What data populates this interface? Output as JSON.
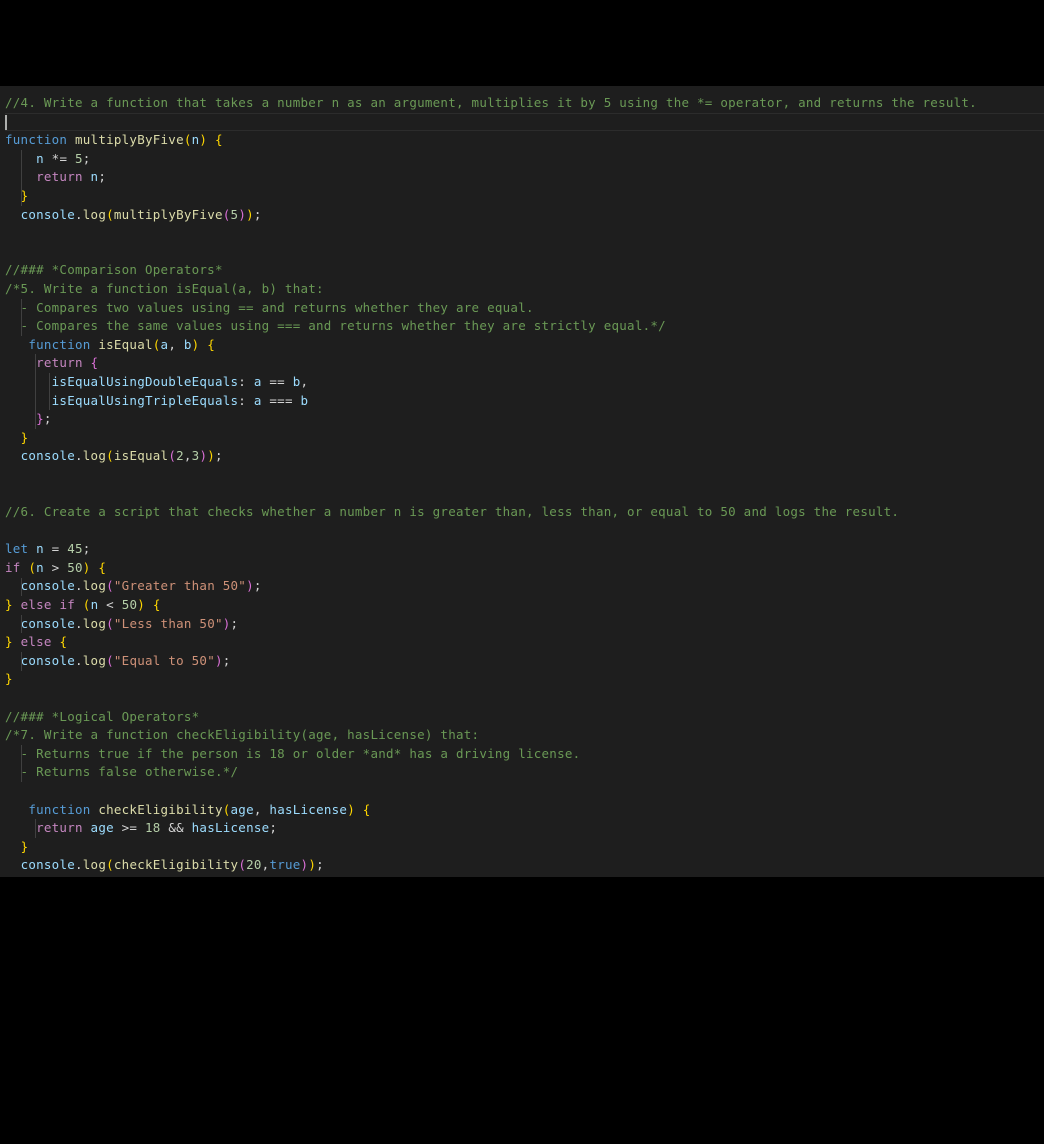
{
  "editor": {
    "lines": [
      [
        {
          "t": "//4. Write a function that takes a number n as an argument, multiplies it by 5 using the *= operator, and returns the result.",
          "c": "comment"
        }
      ],
      [],
      [
        {
          "t": "function",
          "c": "keyword"
        },
        {
          "t": " ",
          "c": "plain"
        },
        {
          "t": "multiplyByFive",
          "c": "func"
        },
        {
          "t": "(",
          "c": "brace1"
        },
        {
          "t": "n",
          "c": "var"
        },
        {
          "t": ")",
          "c": "brace1"
        },
        {
          "t": " ",
          "c": "plain"
        },
        {
          "t": "{",
          "c": "brace1"
        }
      ],
      [
        {
          "t": "    ",
          "c": "plain"
        },
        {
          "t": "n",
          "c": "var"
        },
        {
          "t": " *= ",
          "c": "plain"
        },
        {
          "t": "5",
          "c": "num"
        },
        {
          "t": ";",
          "c": "plain"
        }
      ],
      [
        {
          "t": "    ",
          "c": "plain"
        },
        {
          "t": "return",
          "c": "control"
        },
        {
          "t": " ",
          "c": "plain"
        },
        {
          "t": "n",
          "c": "var"
        },
        {
          "t": ";",
          "c": "plain"
        }
      ],
      [
        {
          "t": "  ",
          "c": "plain"
        },
        {
          "t": "}",
          "c": "brace1"
        }
      ],
      [
        {
          "t": "  ",
          "c": "plain"
        },
        {
          "t": "console",
          "c": "var"
        },
        {
          "t": ".",
          "c": "plain"
        },
        {
          "t": "log",
          "c": "func"
        },
        {
          "t": "(",
          "c": "brace1"
        },
        {
          "t": "multiplyByFive",
          "c": "func"
        },
        {
          "t": "(",
          "c": "brace2"
        },
        {
          "t": "5",
          "c": "num"
        },
        {
          "t": ")",
          "c": "brace2"
        },
        {
          "t": ")",
          "c": "brace1"
        },
        {
          "t": ";",
          "c": "plain"
        }
      ],
      [],
      [],
      [
        {
          "t": "//### *Comparison Operators*",
          "c": "comment"
        }
      ],
      [
        {
          "t": "/*5. Write a function isEqual(a, b) that:",
          "c": "comment"
        }
      ],
      [
        {
          "t": "  - Compares two values using == and returns whether they are equal.",
          "c": "comment"
        }
      ],
      [
        {
          "t": "  - Compares the same values using === and returns whether they are strictly equal.*/",
          "c": "comment"
        }
      ],
      [
        {
          "t": "   ",
          "c": "plain"
        },
        {
          "t": "function",
          "c": "keyword"
        },
        {
          "t": " ",
          "c": "plain"
        },
        {
          "t": "isEqual",
          "c": "func"
        },
        {
          "t": "(",
          "c": "brace1"
        },
        {
          "t": "a",
          "c": "var"
        },
        {
          "t": ", ",
          "c": "plain"
        },
        {
          "t": "b",
          "c": "var"
        },
        {
          "t": ")",
          "c": "brace1"
        },
        {
          "t": " ",
          "c": "plain"
        },
        {
          "t": "{",
          "c": "brace1"
        }
      ],
      [
        {
          "t": "    ",
          "c": "plain"
        },
        {
          "t": "return",
          "c": "control"
        },
        {
          "t": " ",
          "c": "plain"
        },
        {
          "t": "{",
          "c": "brace2"
        }
      ],
      [
        {
          "t": "      ",
          "c": "plain"
        },
        {
          "t": "isEqualUsingDoubleEquals",
          "c": "var"
        },
        {
          "t": ": ",
          "c": "plain"
        },
        {
          "t": "a",
          "c": "var"
        },
        {
          "t": " == ",
          "c": "plain"
        },
        {
          "t": "b",
          "c": "var"
        },
        {
          "t": ",",
          "c": "plain"
        }
      ],
      [
        {
          "t": "      ",
          "c": "plain"
        },
        {
          "t": "isEqualUsingTripleEquals",
          "c": "var"
        },
        {
          "t": ": ",
          "c": "plain"
        },
        {
          "t": "a",
          "c": "var"
        },
        {
          "t": " === ",
          "c": "plain"
        },
        {
          "t": "b",
          "c": "var"
        }
      ],
      [
        {
          "t": "    ",
          "c": "plain"
        },
        {
          "t": "}",
          "c": "brace2"
        },
        {
          "t": ";",
          "c": "plain"
        }
      ],
      [
        {
          "t": "  ",
          "c": "plain"
        },
        {
          "t": "}",
          "c": "brace1"
        }
      ],
      [
        {
          "t": "  ",
          "c": "plain"
        },
        {
          "t": "console",
          "c": "var"
        },
        {
          "t": ".",
          "c": "plain"
        },
        {
          "t": "log",
          "c": "func"
        },
        {
          "t": "(",
          "c": "brace1"
        },
        {
          "t": "isEqual",
          "c": "func"
        },
        {
          "t": "(",
          "c": "brace2"
        },
        {
          "t": "2",
          "c": "num"
        },
        {
          "t": ",",
          "c": "plain"
        },
        {
          "t": "3",
          "c": "num"
        },
        {
          "t": ")",
          "c": "brace2"
        },
        {
          "t": ")",
          "c": "brace1"
        },
        {
          "t": ";",
          "c": "plain"
        }
      ],
      [],
      [],
      [
        {
          "t": "//6. Create a script that checks whether a number n is greater than, less than, or equal to 50 and logs the result.",
          "c": "comment"
        }
      ],
      [],
      [
        {
          "t": "let",
          "c": "keyword"
        },
        {
          "t": " ",
          "c": "plain"
        },
        {
          "t": "n",
          "c": "var"
        },
        {
          "t": " = ",
          "c": "plain"
        },
        {
          "t": "45",
          "c": "num"
        },
        {
          "t": ";",
          "c": "plain"
        }
      ],
      [
        {
          "t": "if",
          "c": "control"
        },
        {
          "t": " ",
          "c": "plain"
        },
        {
          "t": "(",
          "c": "brace1"
        },
        {
          "t": "n",
          "c": "var"
        },
        {
          "t": " > ",
          "c": "plain"
        },
        {
          "t": "50",
          "c": "num"
        },
        {
          "t": ")",
          "c": "brace1"
        },
        {
          "t": " ",
          "c": "plain"
        },
        {
          "t": "{",
          "c": "brace1"
        }
      ],
      [
        {
          "t": "  ",
          "c": "plain"
        },
        {
          "t": "console",
          "c": "var"
        },
        {
          "t": ".",
          "c": "plain"
        },
        {
          "t": "log",
          "c": "func"
        },
        {
          "t": "(",
          "c": "brace2"
        },
        {
          "t": "\"Greater than 50\"",
          "c": "str"
        },
        {
          "t": ")",
          "c": "brace2"
        },
        {
          "t": ";",
          "c": "plain"
        }
      ],
      [
        {
          "t": "}",
          "c": "brace1"
        },
        {
          "t": " ",
          "c": "plain"
        },
        {
          "t": "else",
          "c": "control"
        },
        {
          "t": " ",
          "c": "plain"
        },
        {
          "t": "if",
          "c": "control"
        },
        {
          "t": " ",
          "c": "plain"
        },
        {
          "t": "(",
          "c": "brace1"
        },
        {
          "t": "n",
          "c": "var"
        },
        {
          "t": " < ",
          "c": "plain"
        },
        {
          "t": "50",
          "c": "num"
        },
        {
          "t": ")",
          "c": "brace1"
        },
        {
          "t": " ",
          "c": "plain"
        },
        {
          "t": "{",
          "c": "brace1"
        }
      ],
      [
        {
          "t": "  ",
          "c": "plain"
        },
        {
          "t": "console",
          "c": "var"
        },
        {
          "t": ".",
          "c": "plain"
        },
        {
          "t": "log",
          "c": "func"
        },
        {
          "t": "(",
          "c": "brace2"
        },
        {
          "t": "\"Less than 50\"",
          "c": "str"
        },
        {
          "t": ")",
          "c": "brace2"
        },
        {
          "t": ";",
          "c": "plain"
        }
      ],
      [
        {
          "t": "}",
          "c": "brace1"
        },
        {
          "t": " ",
          "c": "plain"
        },
        {
          "t": "else",
          "c": "control"
        },
        {
          "t": " ",
          "c": "plain"
        },
        {
          "t": "{",
          "c": "brace1"
        }
      ],
      [
        {
          "t": "  ",
          "c": "plain"
        },
        {
          "t": "console",
          "c": "var"
        },
        {
          "t": ".",
          "c": "plain"
        },
        {
          "t": "log",
          "c": "func"
        },
        {
          "t": "(",
          "c": "brace2"
        },
        {
          "t": "\"Equal to 50\"",
          "c": "str"
        },
        {
          "t": ")",
          "c": "brace2"
        },
        {
          "t": ";",
          "c": "plain"
        }
      ],
      [
        {
          "t": "}",
          "c": "brace1"
        }
      ],
      [],
      [
        {
          "t": "//### *Logical Operators*",
          "c": "comment"
        }
      ],
      [
        {
          "t": "/*7. Write a function checkEligibility(age, hasLicense) that:",
          "c": "comment"
        }
      ],
      [
        {
          "t": "  - Returns true if the person is 18 or older *and* has a driving license.",
          "c": "comment"
        }
      ],
      [
        {
          "t": "  - Returns false otherwise.*/",
          "c": "comment"
        }
      ],
      [],
      [
        {
          "t": "   ",
          "c": "plain"
        },
        {
          "t": "function",
          "c": "keyword"
        },
        {
          "t": " ",
          "c": "plain"
        },
        {
          "t": "checkEligibility",
          "c": "func"
        },
        {
          "t": "(",
          "c": "brace1"
        },
        {
          "t": "age",
          "c": "var"
        },
        {
          "t": ", ",
          "c": "plain"
        },
        {
          "t": "hasLicense",
          "c": "var"
        },
        {
          "t": ")",
          "c": "brace1"
        },
        {
          "t": " ",
          "c": "plain"
        },
        {
          "t": "{",
          "c": "brace1"
        }
      ],
      [
        {
          "t": "    ",
          "c": "plain"
        },
        {
          "t": "return",
          "c": "control"
        },
        {
          "t": " ",
          "c": "plain"
        },
        {
          "t": "age",
          "c": "var"
        },
        {
          "t": " >= ",
          "c": "plain"
        },
        {
          "t": "18",
          "c": "num"
        },
        {
          "t": " && ",
          "c": "plain"
        },
        {
          "t": "hasLicense",
          "c": "var"
        },
        {
          "t": ";",
          "c": "plain"
        }
      ],
      [
        {
          "t": "  ",
          "c": "plain"
        },
        {
          "t": "}",
          "c": "brace1"
        }
      ],
      [
        {
          "t": "  ",
          "c": "plain"
        },
        {
          "t": "console",
          "c": "var"
        },
        {
          "t": ".",
          "c": "plain"
        },
        {
          "t": "log",
          "c": "func"
        },
        {
          "t": "(",
          "c": "brace1"
        },
        {
          "t": "checkEligibility",
          "c": "func"
        },
        {
          "t": "(",
          "c": "brace2"
        },
        {
          "t": "20",
          "c": "num"
        },
        {
          "t": ",",
          "c": "plain"
        },
        {
          "t": "true",
          "c": "keyword"
        },
        {
          "t": ")",
          "c": "brace2"
        },
        {
          "t": ")",
          "c": "brace1"
        },
        {
          "t": ";",
          "c": "plain"
        }
      ]
    ],
    "active_line": 1,
    "colors": {
      "background": "#1e1e1e",
      "comment": "#6a9955",
      "keyword": "#569cd6",
      "control": "#c586c0",
      "function": "#dcdcaa",
      "variable": "#9cdcfe",
      "number": "#b5cea8",
      "string": "#ce9178"
    }
  }
}
